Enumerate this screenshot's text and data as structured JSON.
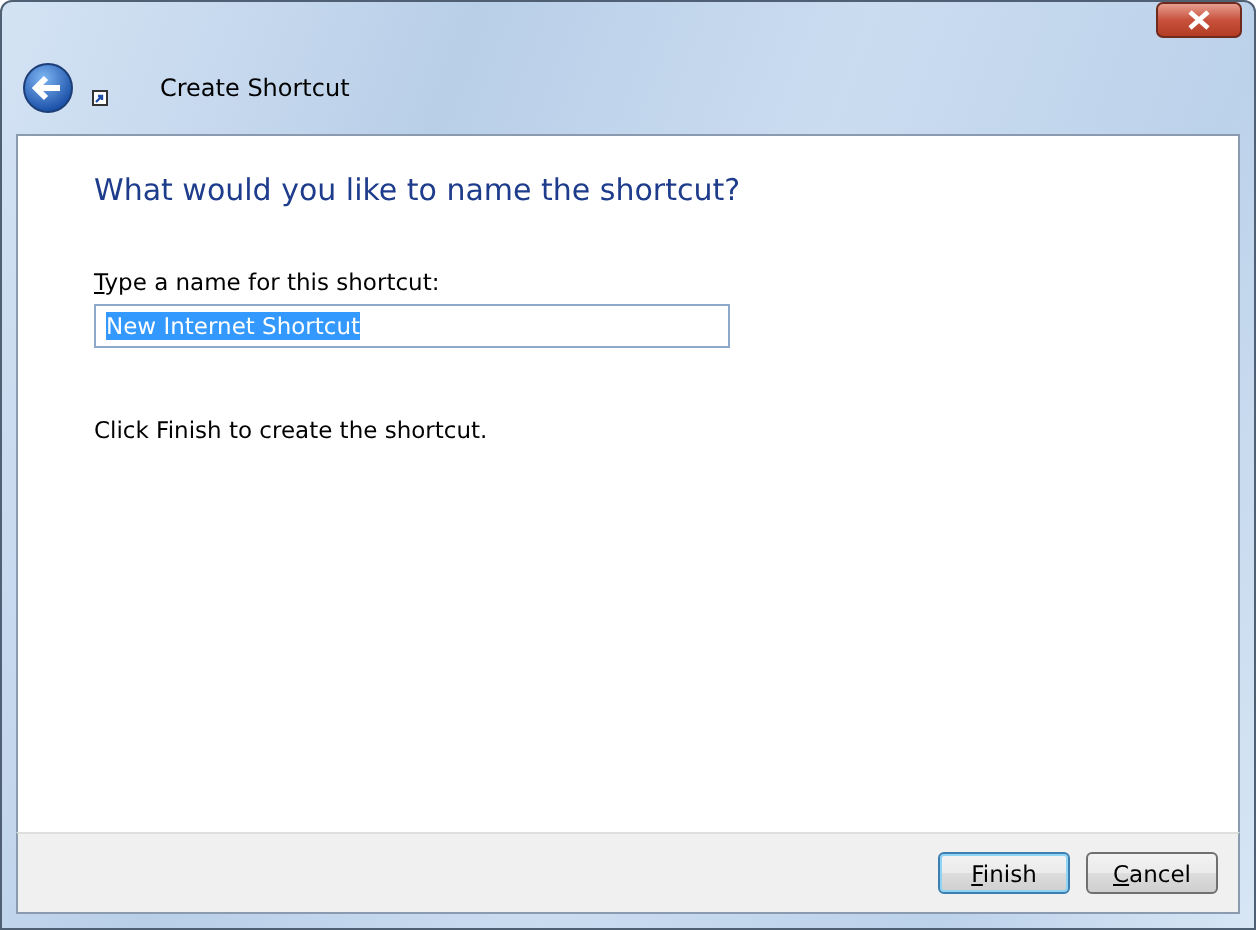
{
  "window": {
    "title": "Create Shortcut"
  },
  "heading": "What would you like to name the shortcut?",
  "name_field": {
    "label": "Type a name for this shortcut:",
    "value": "New Internet Shortcut",
    "selected": true
  },
  "instruction": "Click Finish to create the shortcut.",
  "buttons": [
    {
      "label": "Finish",
      "default": true
    },
    {
      "label": "Cancel",
      "default": false
    }
  ]
}
